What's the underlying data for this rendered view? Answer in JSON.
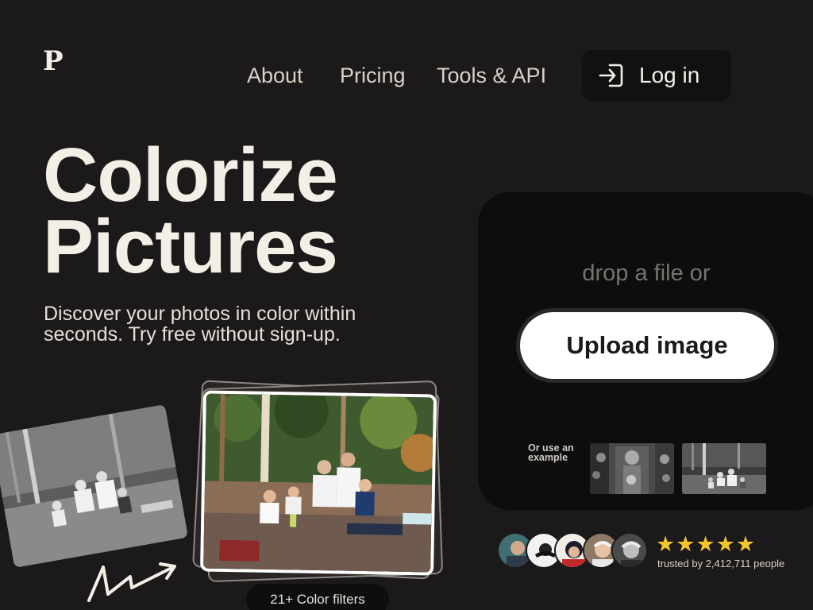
{
  "header": {
    "logo": "P",
    "nav": [
      "About",
      "Pricing",
      "Tools & API"
    ],
    "login_label": "Log in"
  },
  "hero": {
    "headline_line1": "Colorize",
    "headline_line2": "Pictures",
    "subtitle": "Discover your photos in color within seconds. Try free without sign-up."
  },
  "upload": {
    "drop_text": "drop a file or",
    "button_label": "Upload image",
    "example_label": "Or use an example",
    "examples": [
      "example-family-portrait",
      "example-picnic-photo"
    ]
  },
  "social_proof": {
    "rating_stars": 5,
    "star_glyph": "★",
    "trusted_text": "trusted by 2,412,711 people",
    "avatar_count": 5
  },
  "gallery": {
    "filters_label": "21+ Color filters"
  },
  "colors": {
    "background": "#1b1919",
    "card": "#0e0d0d",
    "text": "#f4efe6",
    "star": "#f6c42c",
    "button": "#ffffff"
  }
}
